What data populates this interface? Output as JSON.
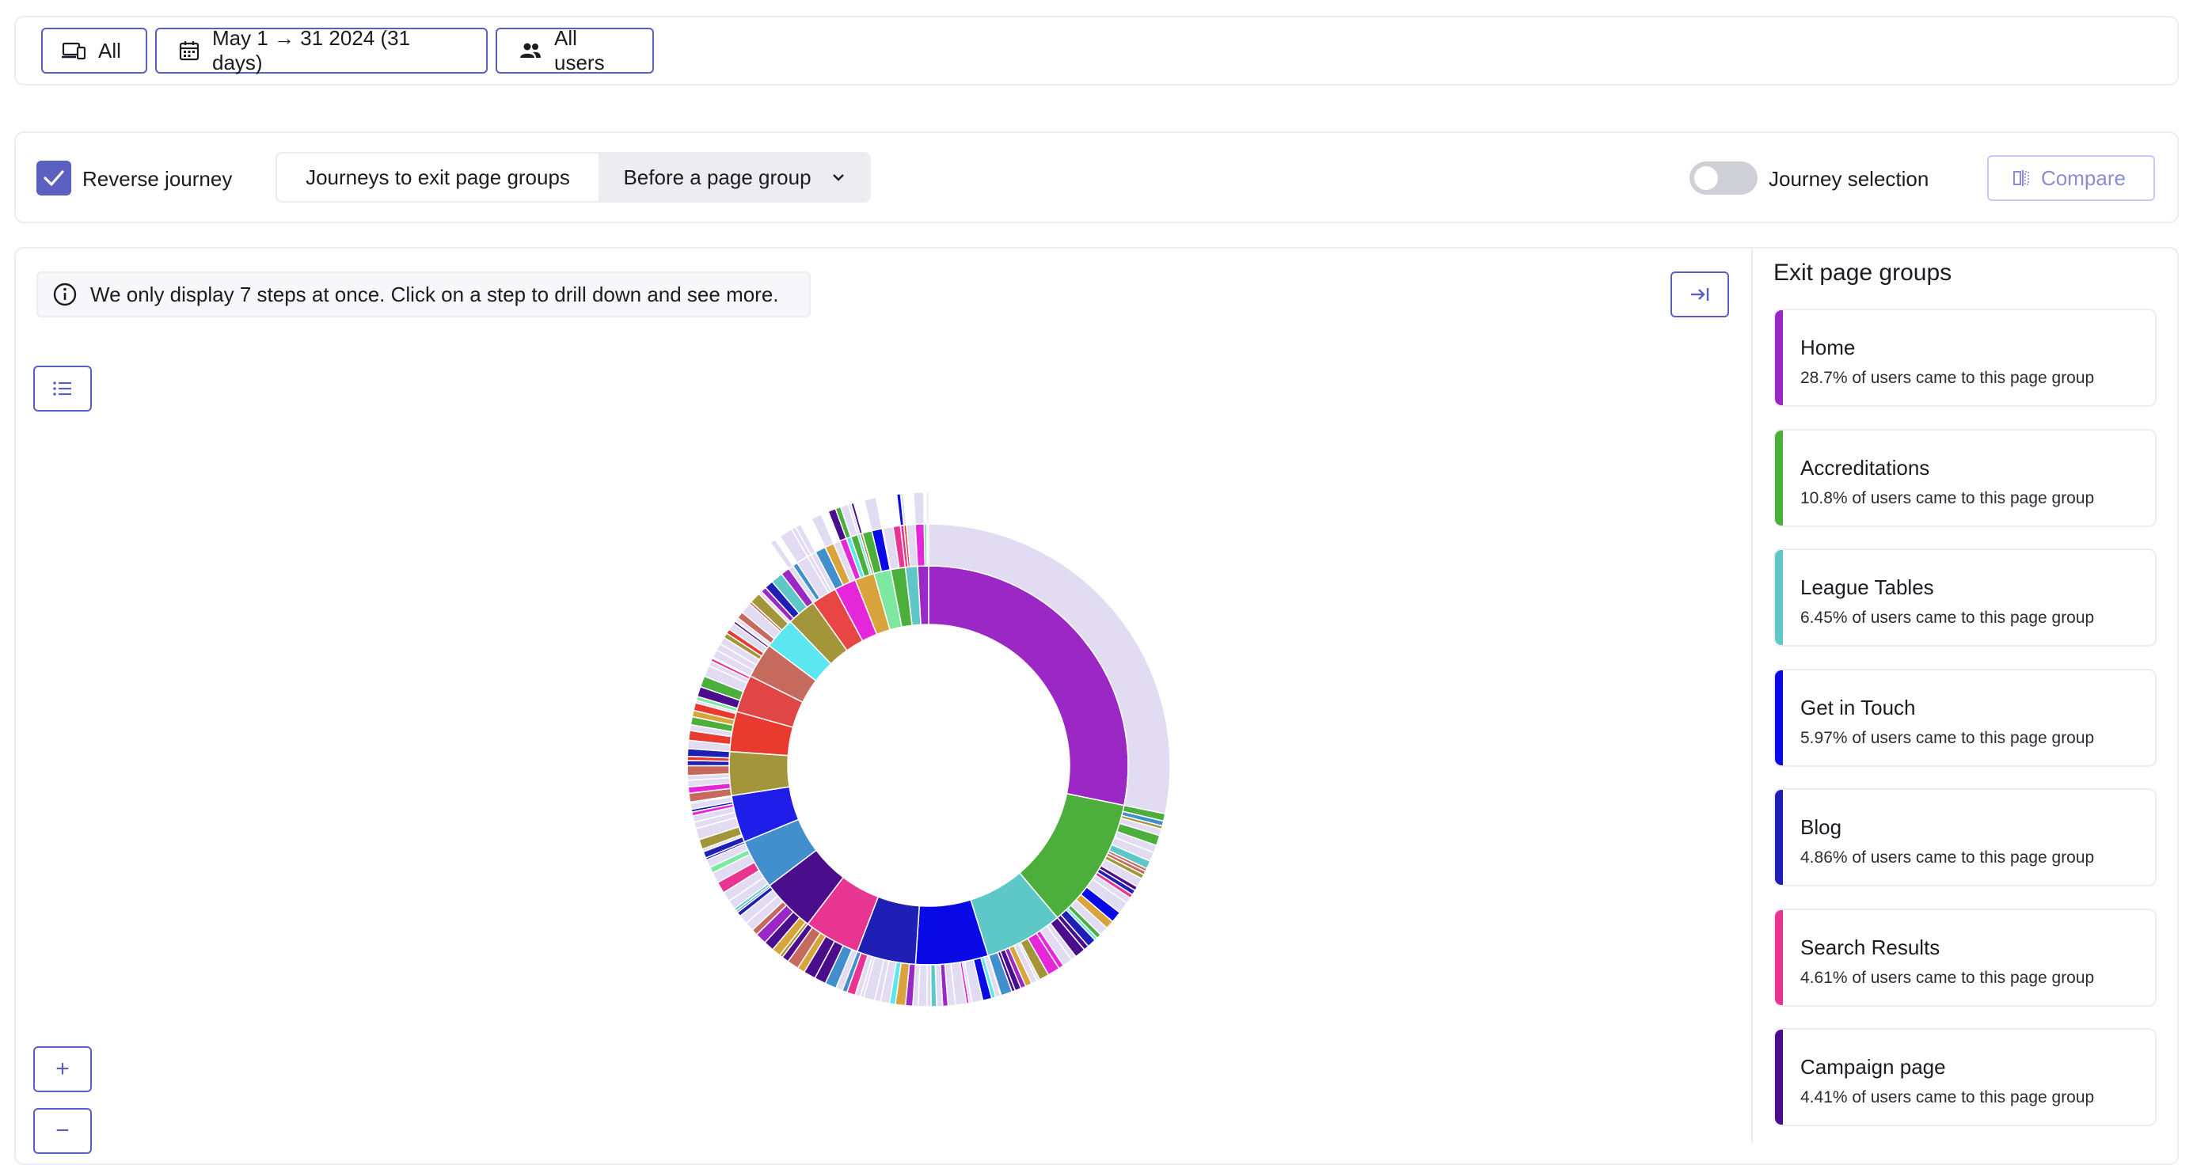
{
  "filters": {
    "device_label": "All",
    "date_label": "May 1 → 31 2024 (31 days)",
    "users_label": "All users"
  },
  "toolbar": {
    "reverse_journey_label": "Reverse journey",
    "reverse_journey_checked": true,
    "segment_left_label": "Journeys to exit page groups",
    "segment_right_label": "Before a page group",
    "journey_selection_label": "Journey selection",
    "journey_selection_on": false,
    "compare_label": "Compare"
  },
  "chart_area": {
    "info_text": "We only display 7 steps at once. Click on a step to drill down and see more.",
    "zoom_in_label": "+",
    "zoom_out_label": "−"
  },
  "chart_data": {
    "type": "sunburst",
    "title": "",
    "inner_ring": [
      {
        "name": "Home",
        "color": "#9b27c4",
        "value": 28.7
      },
      {
        "name": "Accreditations",
        "color": "#4caf3c",
        "value": 10.8
      },
      {
        "name": "League Tables",
        "color": "#5ec8c8",
        "value": 6.45
      },
      {
        "name": "Get in Touch",
        "color": "#0a0ae6",
        "value": 5.97
      },
      {
        "name": "Blog",
        "color": "#1f1fb5",
        "value": 4.86
      },
      {
        "name": "Search Results",
        "color": "#e83591",
        "value": 4.61
      },
      {
        "name": "Campaign page",
        "color": "#4a0e8c",
        "value": 4.41
      },
      {
        "name": "",
        "color": "#428fcd",
        "value": 4.1
      },
      {
        "name": "",
        "color": "#1e1ee8",
        "value": 3.9
      },
      {
        "name": "",
        "color": "#a3963a",
        "value": 3.6
      },
      {
        "name": "",
        "color": "#e83a2e",
        "value": 3.3
      },
      {
        "name": "",
        "color": "#e04646",
        "value": 3.1
      },
      {
        "name": "",
        "color": "#c76a5e",
        "value": 2.9
      },
      {
        "name": "",
        "color": "#5ce6f0",
        "value": 2.6
      },
      {
        "name": "",
        "color": "#a3963a",
        "value": 2.4
      },
      {
        "name": "",
        "color": "#e84545",
        "value": 2.1
      },
      {
        "name": "",
        "color": "#e626d9",
        "value": 1.8
      },
      {
        "name": "",
        "color": "#d9a43c",
        "value": 1.6
      },
      {
        "name": "",
        "color": "#7de8a0",
        "value": 1.4
      },
      {
        "name": "",
        "color": "#4caf3c",
        "value": 1.2
      },
      {
        "name": "",
        "color": "#5ec8c8",
        "value": 1.0
      },
      {
        "name": "",
        "color": "#9b27c4",
        "value": 0.9
      }
    ]
  },
  "legend": {
    "title": "Exit page groups",
    "items": [
      {
        "name": "Home",
        "desc": "28.7% of users came to this page group",
        "color": "#9b27c4"
      },
      {
        "name": "Accreditations",
        "desc": "10.8% of users came to this page group",
        "color": "#4caf3c"
      },
      {
        "name": "League Tables",
        "desc": "6.45% of users came to this page group",
        "color": "#5ec8c8"
      },
      {
        "name": "Get in Touch",
        "desc": "5.97% of users came to this page group",
        "color": "#0a0ae6"
      },
      {
        "name": "Blog",
        "desc": "4.86% of users came to this page group",
        "color": "#1f1fb5"
      },
      {
        "name": "Search Results",
        "desc": "4.61% of users came to this page group",
        "color": "#e83591"
      },
      {
        "name": "Campaign page",
        "desc": "4.41% of users came to this page group",
        "color": "#4a0e8c"
      }
    ]
  },
  "colors": {
    "accent": "#5b5fbf",
    "checkbox": "#5b5fbf",
    "outer_ring_light": "#e1dcf2"
  }
}
